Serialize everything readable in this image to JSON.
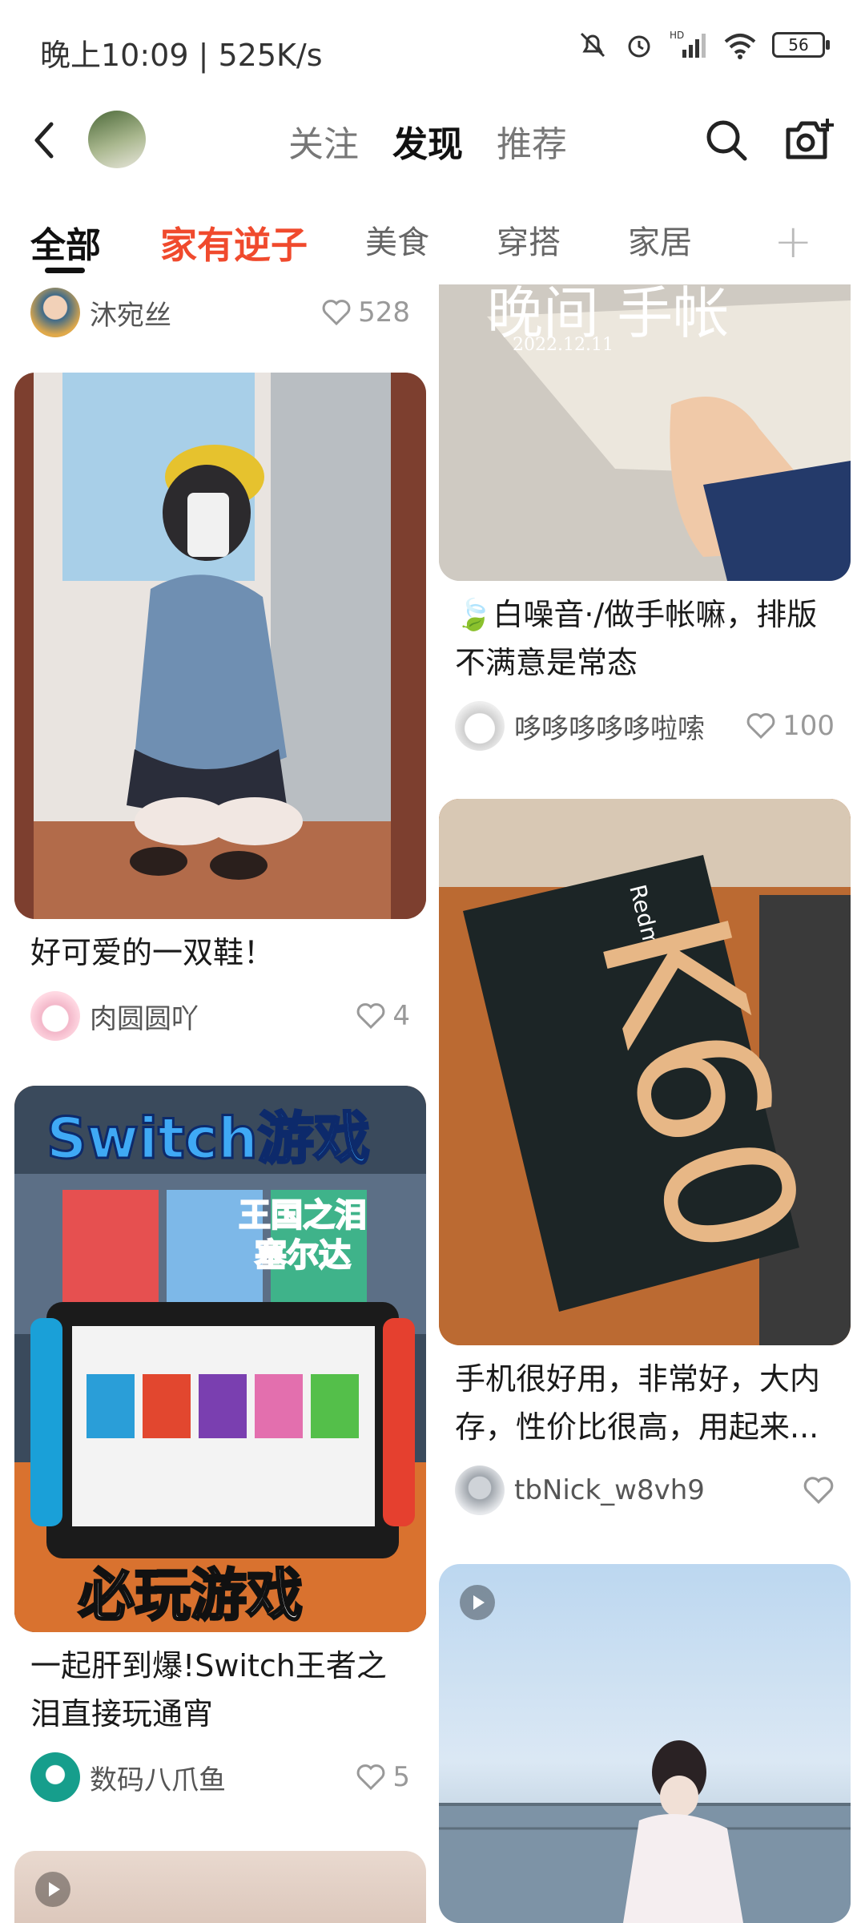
{
  "status": {
    "time": "晚上10:09 | 525K/s",
    "battery": "56"
  },
  "topnav": {
    "tabs": [
      "关注",
      "发现",
      "推荐"
    ],
    "active": "发现"
  },
  "categories": [
    "全部",
    "家有逆子",
    "美食",
    "穿搭",
    "家居"
  ],
  "colors": {
    "accent": "#f04a2d",
    "text": "#1a1a1a",
    "muted": "#999999"
  },
  "left_column": {
    "top_meta": {
      "author": "沐宛丝",
      "likes": "528"
    },
    "cards": [
      {
        "title": "好可爱的一双鞋！",
        "author": "肉圆圆吖",
        "likes": "4"
      },
      {
        "title": "一起肝到爆!Switch王者之泪直接玩通宵",
        "author": "数码八爪鱼",
        "likes": "5",
        "image_text": {
          "banner": "Switch游戏",
          "subtitle": "王国之泪\n塞尔达",
          "footer": "必玩游戏"
        }
      },
      {
        "title": "",
        "author": "",
        "likes": ""
      }
    ]
  },
  "right_column": {
    "cards": [
      {
        "title": "🍃白噪音·/做手帐嘛，排版不满意是常态",
        "author": "哆哆哆哆哆啦嗦",
        "likes": "100",
        "image_text": {
          "heading": "晚间 手帐",
          "date": "2022.12.11"
        }
      },
      {
        "title": "手机很好用，非常好，大内存，性价比很高，用起来...",
        "author": "tbNick_w8vh9",
        "likes": "",
        "image_text": {
          "brand": "Redmi",
          "model": "K60"
        }
      },
      {
        "title": "",
        "author": "",
        "likes": ""
      }
    ]
  }
}
